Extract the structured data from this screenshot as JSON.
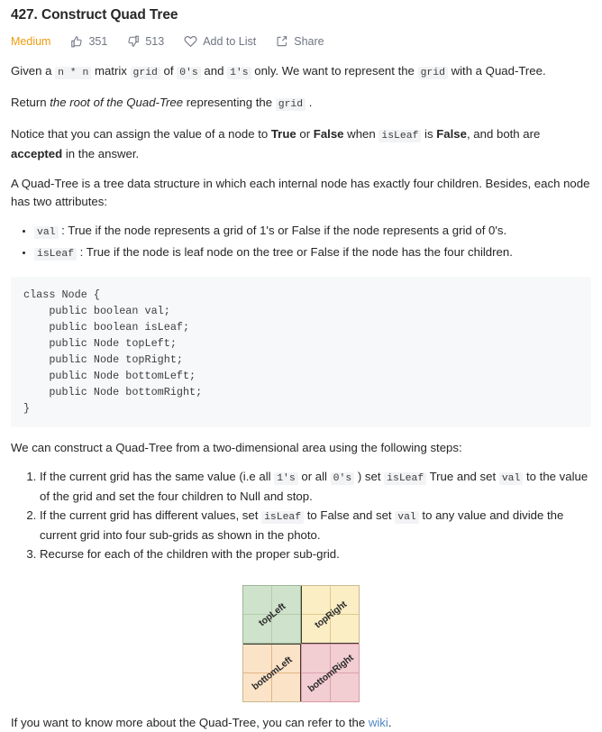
{
  "header": {
    "title": "427. Construct Quad Tree",
    "difficulty": "Medium",
    "likes": "351",
    "dislikes": "513",
    "add_to_list_label": "Add to List",
    "share_label": "Share",
    "difficulty_color": "#ef9b0f",
    "icons": {
      "like": "thumbs-up-icon",
      "dislike": "thumbs-down-icon",
      "add_to_list": "heart-icon",
      "share": "share-icon"
    }
  },
  "content": {
    "p1": {
      "t1": "Given a ",
      "c1": "n * n",
      "t2": " matrix ",
      "c2": "grid",
      "t3": " of ",
      "c3": "0's",
      "t4": " and ",
      "c4": "1's",
      "t5": " only. We want to represent the ",
      "c5": "grid",
      "t6": " with a Quad-Tree."
    },
    "p2": {
      "t1": "Return ",
      "em1": "the root of the Quad-Tree",
      "t2": " representing the ",
      "c1": "grid",
      "t3": " ."
    },
    "p3": {
      "t1": "Notice that you can assign the value of a node to ",
      "b1": "True",
      "t2": " or ",
      "b2": "False",
      "t3": " when ",
      "c1": "isLeaf",
      "t4": " is ",
      "b3": "False",
      "t5": ", and both are ",
      "b4": "accepted",
      "t6": " in the answer."
    },
    "p4": "A Quad-Tree is a tree data structure in which each internal node has exactly four children. Besides, each node has two attributes:",
    "attributes": [
      {
        "code": "val",
        "text": " : True if the node represents a grid of 1's or False if the node represents a grid of 0's."
      },
      {
        "code": "isLeaf",
        "text": " : True if the node is leaf node on the tree or False if the node has the four children."
      }
    ],
    "code_block": "class Node {\n    public boolean val;\n    public boolean isLeaf;\n    public Node topLeft;\n    public Node topRight;\n    public Node bottomLeft;\n    public Node bottomRight;\n}",
    "p5": "We can construct a Quad-Tree from a two-dimensional area using the following steps:",
    "steps": [
      {
        "t1": "If the current grid has the same value (i.e all ",
        "c1": "1's",
        "t2": " or all ",
        "c2": "0's",
        "t3": " ) set ",
        "c3": "isLeaf",
        "t4": " True and set ",
        "c4": "val",
        "t5": " to the value of the grid and set the four children to Null and stop."
      },
      {
        "t1": "If the current grid has different values, set ",
        "c1": "isLeaf",
        "t2": " to False and set ",
        "c2": "val",
        "t3": " to any value and divide the current grid into four sub-grids as shown in the photo.",
        "c3": "",
        "t4": "",
        "c4": "",
        "t5": ""
      },
      {
        "t1": "Recurse for each of the children with the proper sub-grid.",
        "c1": "",
        "t2": "",
        "c2": "",
        "t3": "",
        "c3": "",
        "t4": "",
        "c4": "",
        "t5": ""
      }
    ],
    "footer": {
      "t1": "If you want to know more about the Quad-Tree, you can refer to the ",
      "link": "wiki",
      "t2": "."
    }
  },
  "figure": {
    "name": "quad-tree-subdivision-diagram",
    "quadrants": [
      {
        "key": "topLeft",
        "label": "topLeft",
        "color": "#cfe2cb"
      },
      {
        "key": "topRight",
        "label": "topRight",
        "color": "#fbeec5"
      },
      {
        "key": "bottomLeft",
        "label": "bottomLeft",
        "color": "#fbe3c8"
      },
      {
        "key": "bottomRight",
        "label": "bottomRight",
        "color": "#f2cdd2"
      }
    ]
  }
}
